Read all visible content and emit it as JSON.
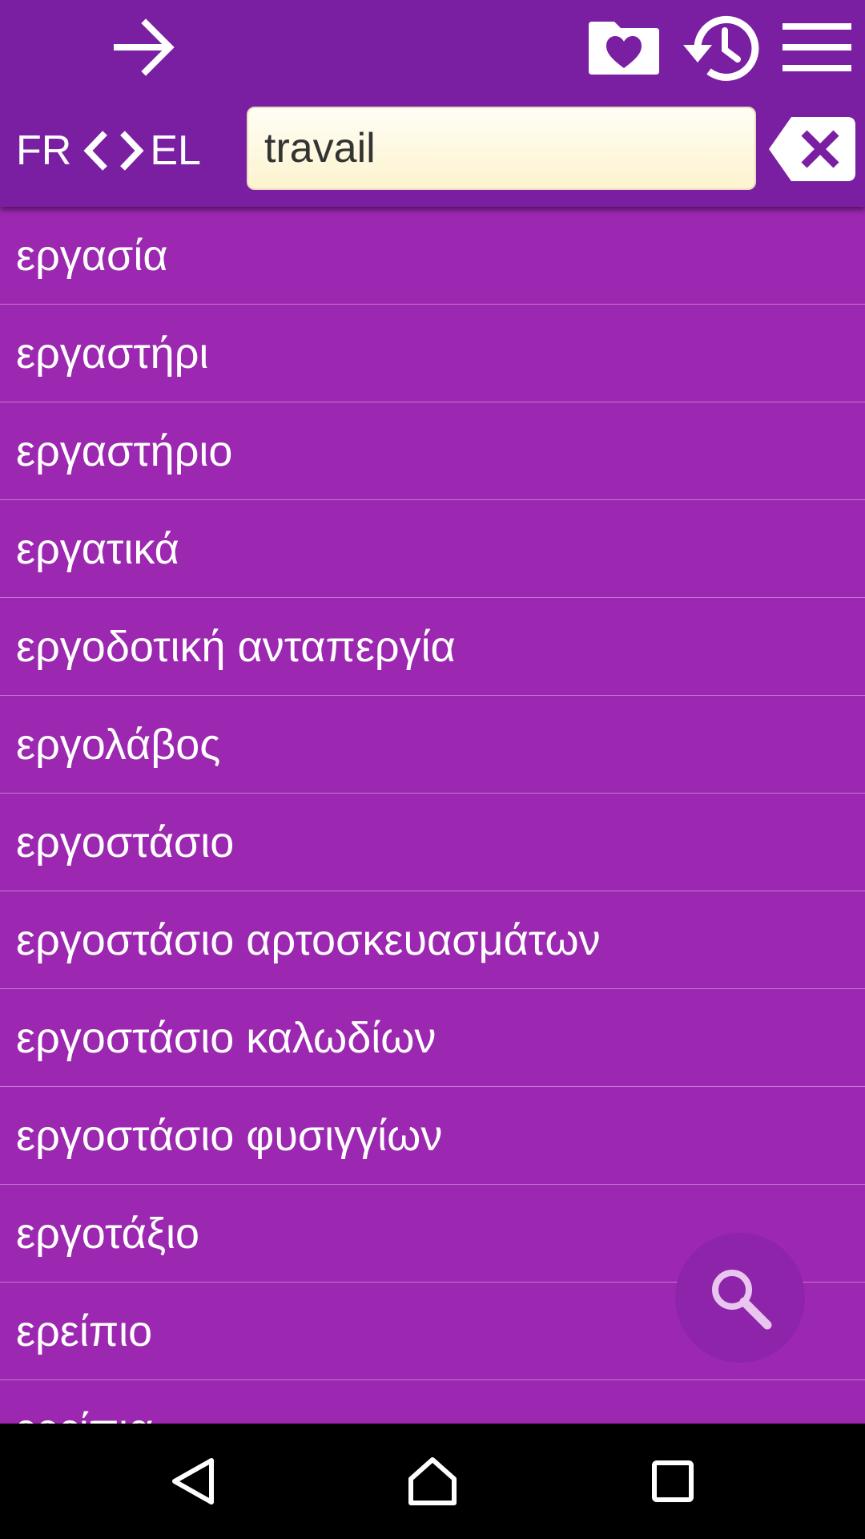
{
  "theme": {
    "toolbar_color": "#7b1fa2",
    "list_color": "#9c27b0",
    "fab_color": "#8e24aa",
    "icon_color": "#ffffff"
  },
  "toolbar": {
    "icons": [
      "arrow-right-icon",
      "heart-folder-icon",
      "history-icon",
      "menu-icon"
    ],
    "source_lang": "FR",
    "target_lang": "EL",
    "search_value": "travail"
  },
  "results": [
    "εργασία",
    "εργαστήρι",
    "εργαστήριο",
    "εργατικά",
    "εργοδοτική ανταπεργία",
    "εργολάβος",
    "εργοστάσιο",
    "εργοστάσιο αρτοσκευασμάτων",
    "εργοστάσιο καλωδίων",
    "εργοστάσιο φυσιγγίων",
    "εργοτάξιο",
    "ερείπιο",
    "ερείπια"
  ],
  "navbar": {
    "icons": [
      "back-icon",
      "home-icon",
      "recents-icon"
    ]
  }
}
